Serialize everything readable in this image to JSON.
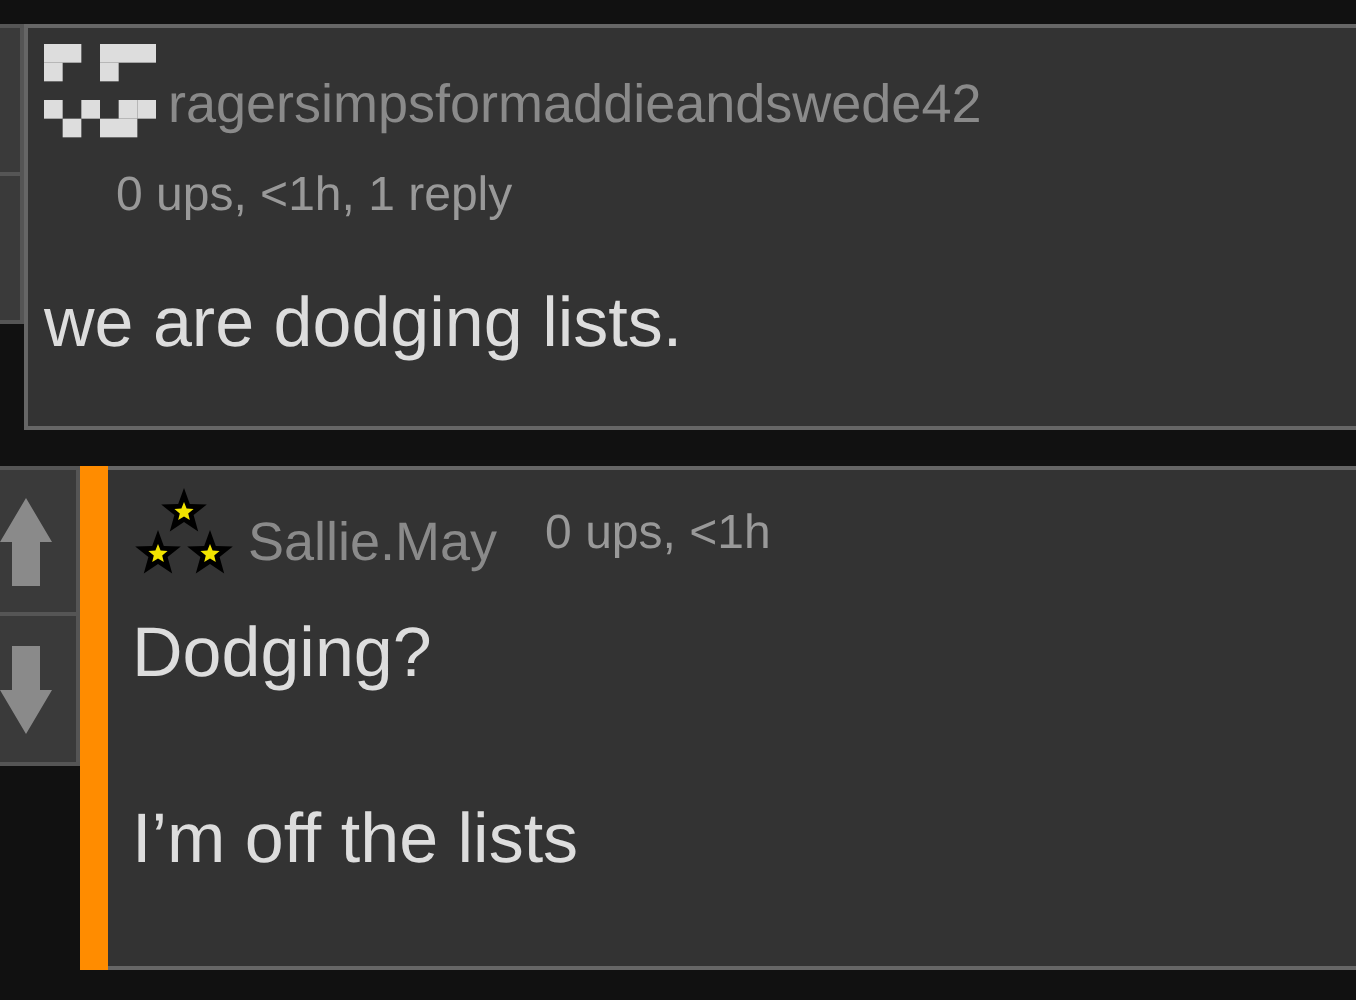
{
  "comments": [
    {
      "kind": "parent",
      "avatar": {
        "kind": "pixel"
      },
      "username": "ragersimpsformaddieandswede42",
      "meta": "0 ups, <1h, 1 reply",
      "highlighted": false,
      "body": [
        "we are dodging lists."
      ]
    },
    {
      "kind": "reply",
      "avatar": {
        "kind": "stars"
      },
      "username": "Sallie.May",
      "meta": "0 ups, <1h",
      "highlighted": true,
      "body": [
        "Dodging?",
        "I’m off the lists"
      ]
    }
  ]
}
